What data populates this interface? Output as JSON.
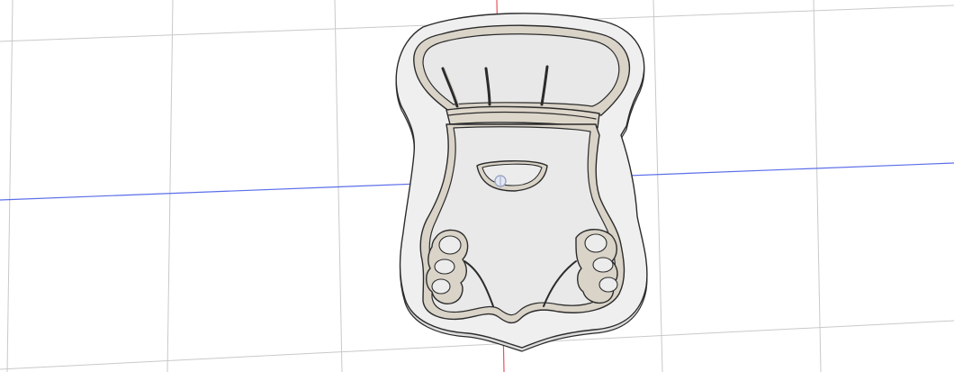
{
  "viewport": {
    "background": "#ffffff",
    "grid_color": "#c9c9c9",
    "x_axis_color": "#5b6ee8",
    "y_axis_color": "#e8535c",
    "origin_marker_color": "#9aa6c6"
  },
  "model": {
    "name_icon": "chef-gnome-cookie-cutter-icon",
    "base_fill": "#ececec",
    "wall_fill": "#d8d2c8",
    "outline_color": "#2b2b2b",
    "inner_fill": "#e6e6e6"
  }
}
